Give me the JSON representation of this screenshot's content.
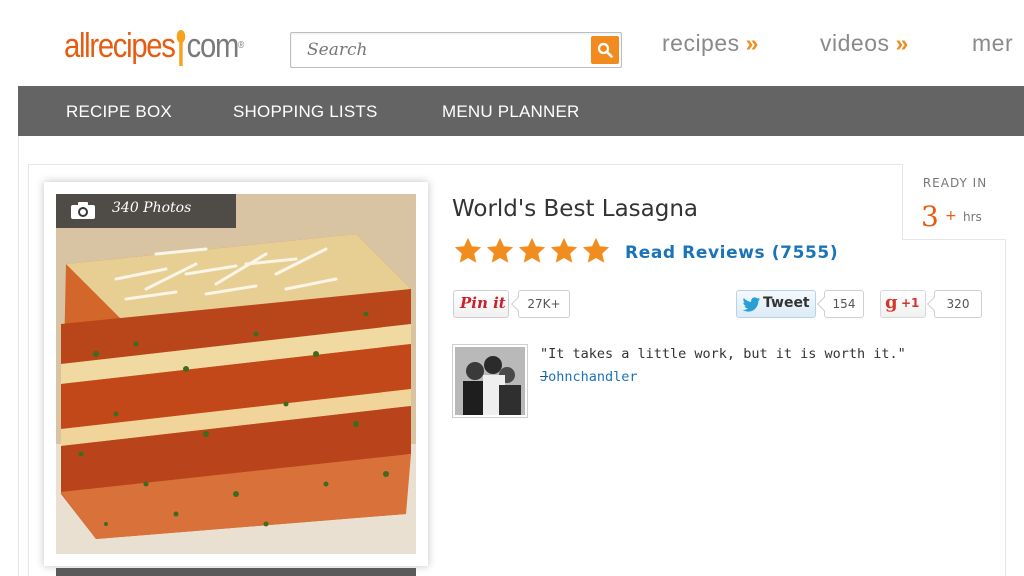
{
  "header": {
    "logo": {
      "part1": "allrecipes",
      "part2": "com",
      "trademark": "®"
    },
    "search": {
      "placeholder": "Search",
      "value": ""
    },
    "nav": [
      {
        "label": "recipes",
        "arrow": "»"
      },
      {
        "label": "videos",
        "arrow": "»"
      },
      {
        "label": "mer"
      }
    ]
  },
  "subnav": {
    "items": [
      "RECIPE BOX",
      "SHOPPING LISTS",
      "MENU PLANNER"
    ]
  },
  "recipe": {
    "photo_count": "340 Photos",
    "title": "World's Best Lasagna",
    "rating_stars": 5,
    "reviews_link": "Read Reviews (7555)",
    "ready_in": {
      "label": "READY IN",
      "value": "3",
      "plus": "+",
      "unit": "hrs"
    }
  },
  "social": {
    "pin_label": "Pin it",
    "pin_count": "27K+",
    "tweet_label": "Tweet",
    "tweet_count": "154",
    "gplus_label": "+1",
    "gplus_count": "320"
  },
  "quote": {
    "text": "\"It takes a little work, but it is worth it.\" —",
    "author": "Johnchandler"
  },
  "colors": {
    "brand_orange": "#e85b10",
    "accent_orange": "#f18b1f",
    "star": "#f28c1f",
    "link_blue": "#1b74b8",
    "subnav_bg": "#646464"
  }
}
